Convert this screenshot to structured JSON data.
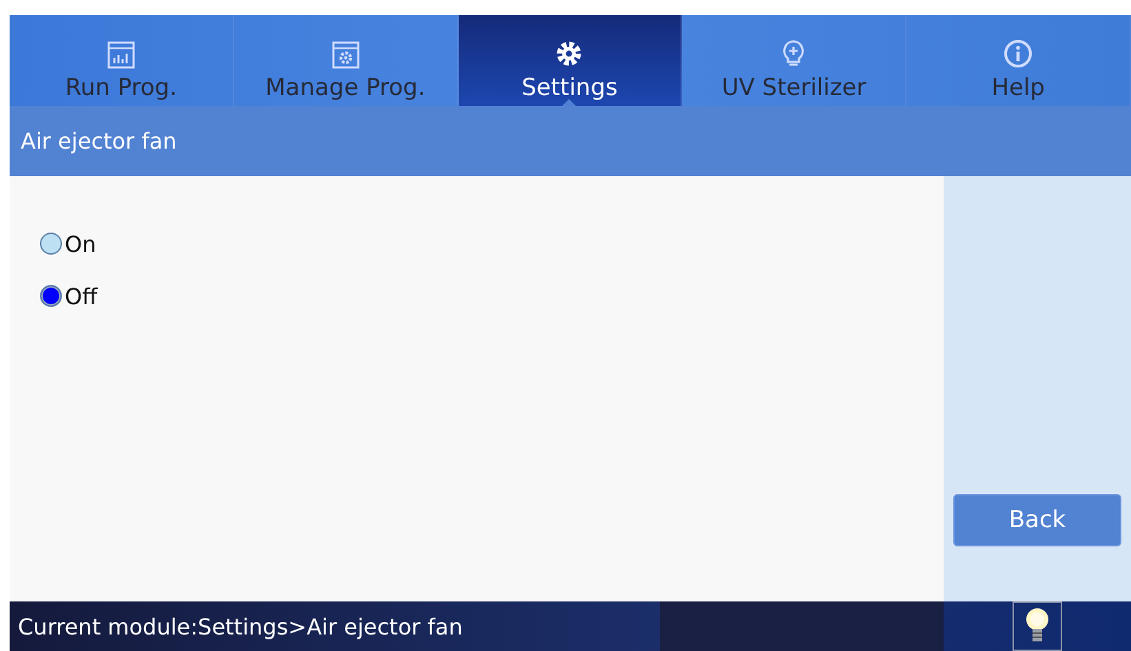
{
  "tabs": [
    {
      "label": "Run Prog.",
      "kind": "chart",
      "selected": false
    },
    {
      "label": "Manage Prog.",
      "kind": "gearbox",
      "selected": false
    },
    {
      "label": "Settings",
      "kind": "gear",
      "selected": true
    },
    {
      "label": "UV Sterilizer",
      "kind": "bulb",
      "selected": false
    },
    {
      "label": "Help",
      "kind": "info",
      "selected": false
    }
  ],
  "header": {
    "title": "Air ejector fan"
  },
  "options": [
    {
      "label": "On",
      "selected": false
    },
    {
      "label": "Off",
      "selected": true
    }
  ],
  "buttons": [
    "Back"
  ],
  "status_bar": {
    "text": "Current module:Settings>Air ejector fan"
  }
}
